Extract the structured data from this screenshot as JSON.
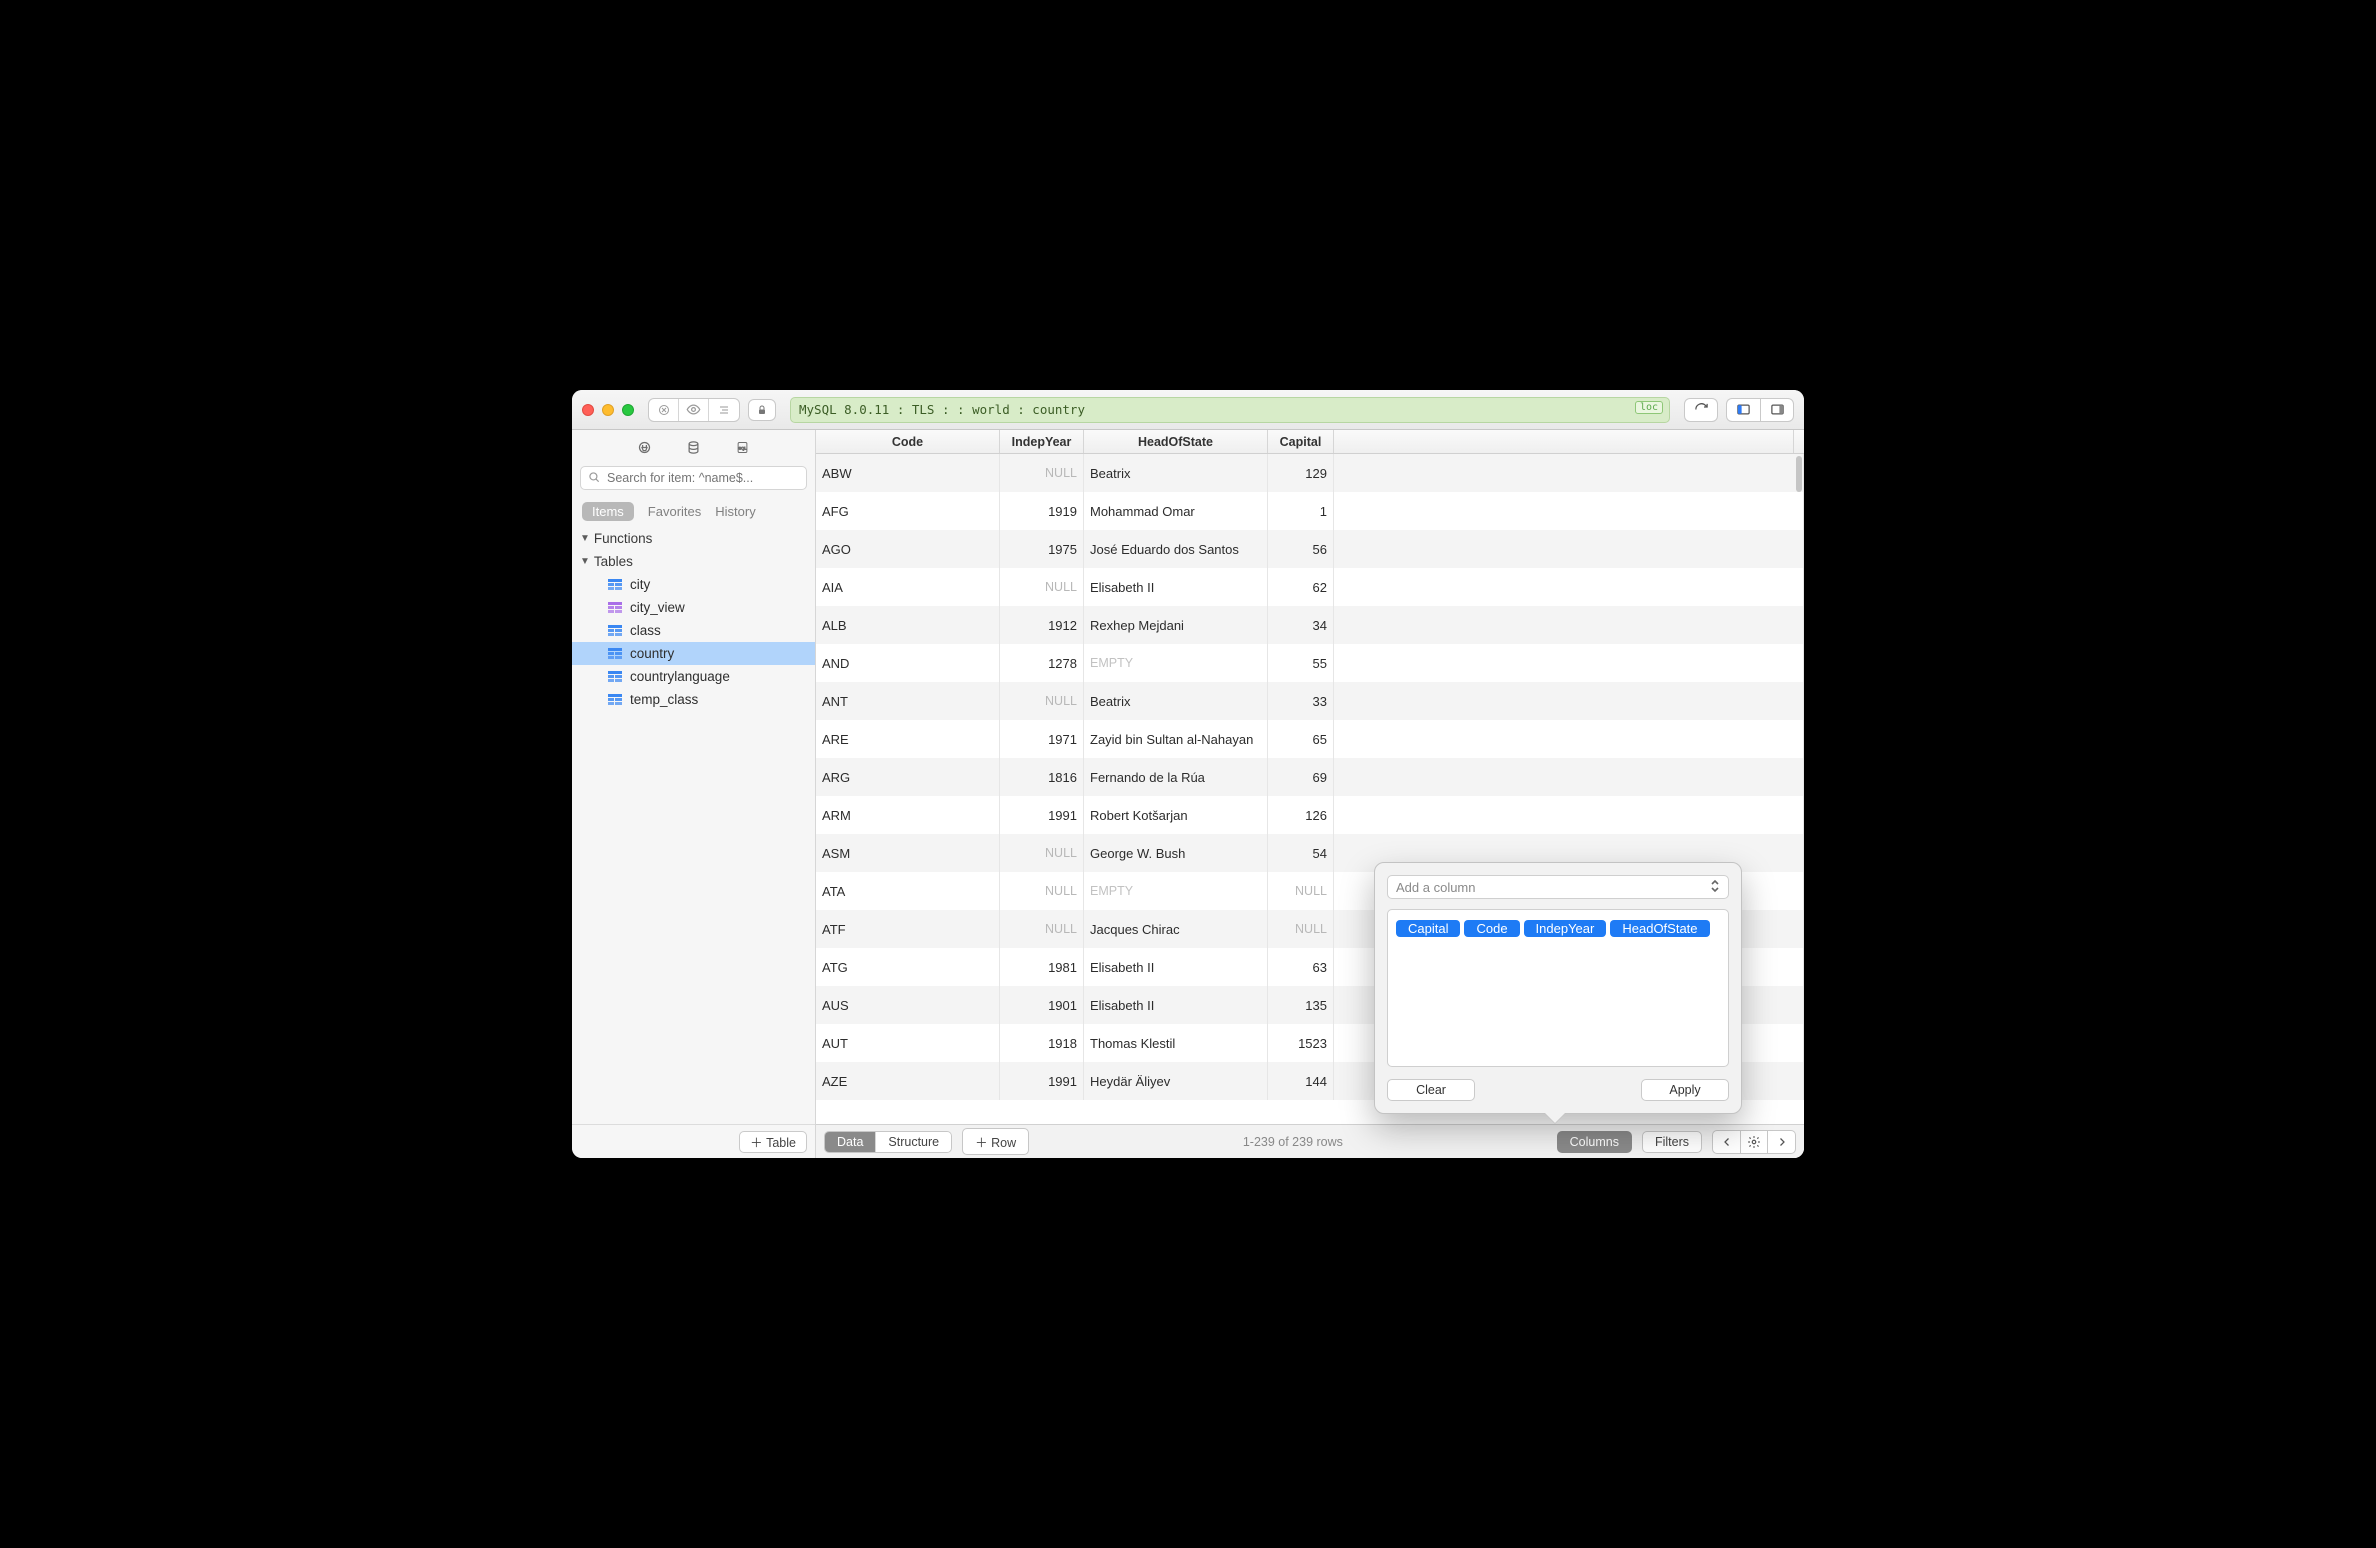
{
  "toolbar": {
    "connection_text": "MySQL 8.0.11 : TLS :  : world : country",
    "loc_badge": "loc"
  },
  "sidebar": {
    "search_placeholder": "Search for item: ^name$...",
    "tabs": {
      "items": "Items",
      "favorites": "Favorites",
      "history": "History"
    },
    "groups": {
      "functions": "Functions",
      "tables": "Tables"
    },
    "tables": [
      {
        "label": "city",
        "kind": "table"
      },
      {
        "label": "city_view",
        "kind": "view"
      },
      {
        "label": "class",
        "kind": "table"
      },
      {
        "label": "country",
        "kind": "table"
      },
      {
        "label": "countrylanguage",
        "kind": "table"
      },
      {
        "label": "temp_class",
        "kind": "table"
      }
    ],
    "add_table_btn": "Table"
  },
  "grid": {
    "columns": {
      "code": "Code",
      "indep": "IndepYear",
      "head": "HeadOfState",
      "capital": "Capital"
    },
    "rows": [
      {
        "code": "ABW",
        "indep": null,
        "head": "Beatrix",
        "capital": "129"
      },
      {
        "code": "AFG",
        "indep": "1919",
        "head": "Mohammad Omar",
        "capital": "1"
      },
      {
        "code": "AGO",
        "indep": "1975",
        "head": "José Eduardo dos Santos",
        "capital": "56"
      },
      {
        "code": "AIA",
        "indep": null,
        "head": "Elisabeth II",
        "capital": "62"
      },
      {
        "code": "ALB",
        "indep": "1912",
        "head": "Rexhep Mejdani",
        "capital": "34"
      },
      {
        "code": "AND",
        "indep": "1278",
        "head": "",
        "capital": "55"
      },
      {
        "code": "ANT",
        "indep": null,
        "head": "Beatrix",
        "capital": "33"
      },
      {
        "code": "ARE",
        "indep": "1971",
        "head": "Zayid bin Sultan al-Nahayan",
        "capital": "65"
      },
      {
        "code": "ARG",
        "indep": "1816",
        "head": "Fernando de la Rúa",
        "capital": "69"
      },
      {
        "code": "ARM",
        "indep": "1991",
        "head": "Robert Kotšarjan",
        "capital": "126"
      },
      {
        "code": "ASM",
        "indep": null,
        "head": "George W. Bush",
        "capital": "54"
      },
      {
        "code": "ATA",
        "indep": null,
        "head": "",
        "capital": null
      },
      {
        "code": "ATF",
        "indep": null,
        "head": "Jacques Chirac",
        "capital": null
      },
      {
        "code": "ATG",
        "indep": "1981",
        "head": "Elisabeth II",
        "capital": "63"
      },
      {
        "code": "AUS",
        "indep": "1901",
        "head": "Elisabeth II",
        "capital": "135"
      },
      {
        "code": "AUT",
        "indep": "1918",
        "head": "Thomas Klestil",
        "capital": "1523"
      },
      {
        "code": "AZE",
        "indep": "1991",
        "head": "Heydär Äliyev",
        "capital": "144"
      }
    ]
  },
  "bottombar": {
    "data": "Data",
    "structure": "Structure",
    "add_row": "Row",
    "status": "1-239 of 239 rows",
    "columns": "Columns",
    "filters": "Filters"
  },
  "popover": {
    "placeholder": "Add a column",
    "tags": [
      "Capital",
      "Code",
      "IndepYear",
      "HeadOfState"
    ],
    "clear": "Clear",
    "apply": "Apply"
  }
}
